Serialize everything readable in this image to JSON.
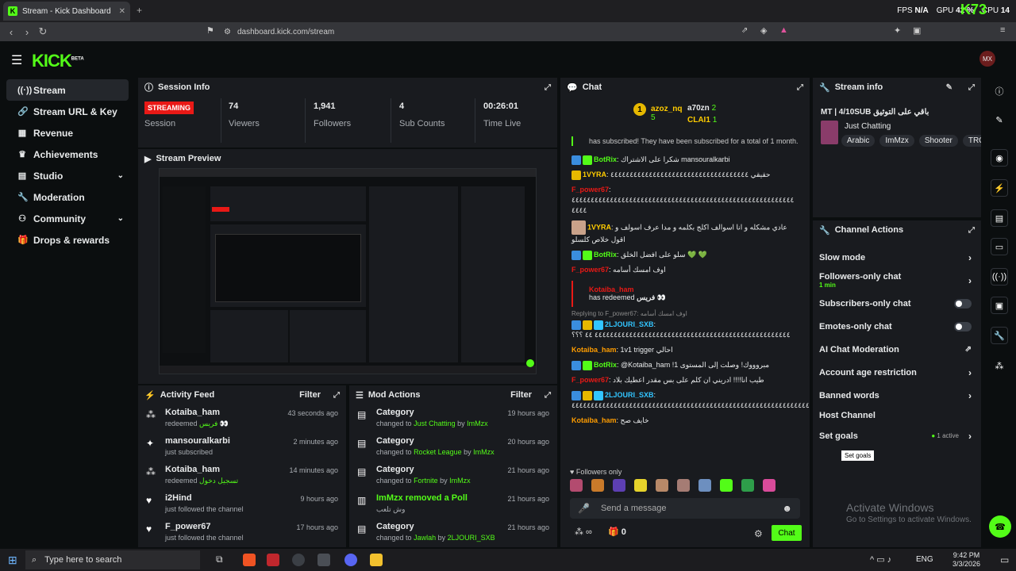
{
  "browser": {
    "tab_title": "Stream - Kick Dashboard",
    "url": "dashboard.kick.com/stream",
    "perf": {
      "fps_label": "FPS",
      "fps": "N/A",
      "gpu_label": "GPU",
      "gpu": "42 %",
      "cpu_label": "CPU",
      "cpu": "14"
    },
    "overlay_logo": "K73"
  },
  "app": {
    "logo": "KICK",
    "logo_sup": "BETA",
    "avatar": "MX"
  },
  "sidebar": {
    "items": [
      {
        "label": "Stream",
        "icon": "signal-icon"
      },
      {
        "label": "Stream URL & Key",
        "icon": "link-icon"
      },
      {
        "label": "Revenue",
        "icon": "chart-icon"
      },
      {
        "label": "Achievements",
        "icon": "trophy-icon"
      },
      {
        "label": "Studio",
        "icon": "studio-icon"
      },
      {
        "label": "Moderation",
        "icon": "wrench-icon"
      },
      {
        "label": "Community",
        "icon": "people-icon"
      },
      {
        "label": "Drops & rewards",
        "icon": "gift-icon"
      }
    ]
  },
  "session": {
    "title": "Session Info",
    "status": "STREAMING",
    "status_label": "Session",
    "viewers": "74",
    "viewers_label": "Viewers",
    "followers": "1,941",
    "followers_label": "Followers",
    "subs": "4",
    "subs_label": "Sub Counts",
    "time": "00:26:01",
    "time_label": "Time Live"
  },
  "preview": {
    "title": "Stream Preview"
  },
  "activity": {
    "title": "Activity Feed",
    "filter": "Filter",
    "items": [
      {
        "user": "Kotaiba_ham",
        "action": "redeemed",
        "extra": "فريس 👀",
        "time": "43 seconds ago"
      },
      {
        "user": "mansouralkarbi",
        "action": "just subscribed",
        "extra": "",
        "time": "2 minutes ago"
      },
      {
        "user": "Kotaiba_ham",
        "action": "redeemed",
        "extra": "تسجيل دخول",
        "time": "14 minutes ago"
      },
      {
        "user": "i2Hind",
        "action": "just followed the channel",
        "extra": "",
        "time": "9 hours ago"
      },
      {
        "user": "F_power67",
        "action": "just followed the channel",
        "extra": "",
        "time": "17 hours ago"
      }
    ]
  },
  "mod": {
    "title": "Mod Actions",
    "filter": "Filter",
    "items": [
      {
        "head": "Category",
        "pre": "changed to",
        "target": "Just Chatting",
        "by": "by",
        "who": "ImMzx",
        "time": "19 hours ago"
      },
      {
        "head": "Category",
        "pre": "changed to",
        "target": "Rocket League",
        "by": "by",
        "who": "ImMzx",
        "time": "20 hours ago"
      },
      {
        "head": "Category",
        "pre": "changed to",
        "target": "Fortnite",
        "by": "by",
        "who": "ImMzx",
        "time": "21 hours ago"
      },
      {
        "head": "ImMzx removed a Poll",
        "pre": "وش تلعب",
        "target": "",
        "by": "",
        "who": "",
        "time": "21 hours ago"
      },
      {
        "head": "Category",
        "pre": "changed to",
        "target": "Jawlah",
        "by": "by",
        "who": "2LJOURI_SXB",
        "time": "21 hours ago"
      }
    ]
  },
  "chat": {
    "title": "Chat",
    "top": [
      {
        "user": "azoz_nq",
        "count": "5"
      },
      {
        "user": "a70zn",
        "count": "2"
      },
      {
        "user": "CLAI1",
        "count": "1"
      }
    ],
    "sub_notice": "has subscribed! They have been subscribed for a total of 1 month.",
    "messages": [
      {
        "user": "BotRix",
        "color": "#53fc18",
        "text": "شكرا على الاشتراك mansouralkarbi"
      },
      {
        "user": "1VYRA",
        "color": "#ffcc00",
        "text": "حقيقي ٤٤٤٤٤٤٤٤٤٤٤٤٤٤٤٤٤٤٤٤٤٤٤٤٤٤٤٤٤٤٤٤٤٤٤٤"
      },
      {
        "user": "F_power67",
        "color": "#e91916",
        "text": "٤٤٤٤٤٤٤٤٤٤٤٤٤٤٤٤٤٤٤٤٤٤٤٤٤٤٤٤٤٤٤٤٤٤٤٤٤٤٤٤٤٤٤٤٤٤٤٤٤٤٤٤٤٤٤٤٤٤ ٤٤٤٤"
      },
      {
        "user": "1VYRA",
        "color": "#ffcc00",
        "text": "عادي مشكله و انا اسوالف اكلج بكلمه و مدا عرف اسولف و اقول خلاص كلسلو"
      },
      {
        "user": "BotRix",
        "color": "#53fc18",
        "text": "سلو على افضل الخلق 💚 💚"
      },
      {
        "user": "F_power67",
        "color": "#e91916",
        "text": "اوف امسك أسامه"
      }
    ],
    "redeem": {
      "user": "Kotaiba_ham",
      "text": "has redeemed",
      "reward": "فريس 👀"
    },
    "reply_to": "Replying to F_power67: اوف امسك أسامه",
    "messages2": [
      {
        "user": "2LJOURI_SXB",
        "color": "#32c5ff",
        "text": "٤٤٤٤٤٤٤٤٤٤٤٤٤٤٤٤٤٤٤٤٤٤٤٤٤٤٤٤٤٤٤٤٤٤٤٤٤٤٤٤٤٤٤٤٤٤٤٤٤٤٤ ٤٤ ؟؟؟"
      },
      {
        "user": "Kotaiba_ham",
        "color": "#ff9d00",
        "text": "1v1 trigger احالي"
      },
      {
        "user": "BotRix",
        "color": "#53fc18",
        "text": "@Kotaiba_ham !مبروووك! وصلت إلى المستوى 1"
      },
      {
        "user": "F_power67",
        "color": "#e91916",
        "text": "طيب انا!!!! ادريني ان كلم على بس مقدر اعطيك بلاد"
      },
      {
        "user": "2LJOURI_SXB",
        "color": "#32c5ff",
        "text": "٤٤٤٤٤٤٤٤٤٤٤٤٤٤٤٤٤٤٤٤٤٤٤٤٤٤٤٤٤٤٤٤٤٤٤٤٤٤٤٤٤٤٤٤٤٤٤٤٤٤٤٤٤٤٤٤٤٤٤٤٤٤"
      },
      {
        "user": "Kotaiba_ham",
        "color": "#ff9d00",
        "text": "خايف صح"
      }
    ],
    "followers_only": "Followers only",
    "placeholder": "Send a message",
    "send": "Chat",
    "count": "0"
  },
  "stream_info": {
    "title": "Stream info",
    "stream_title": "MT | 4/10SUB باقي على التوثيق",
    "category": "Just Chatting",
    "tags": [
      "Arabic",
      "ImMzx",
      "Shooter",
      "TRO"
    ]
  },
  "actions": {
    "title": "Channel Actions",
    "items": [
      {
        "label": "Slow mode",
        "kind": "chev",
        "sub": ""
      },
      {
        "label": "Followers-only chat",
        "kind": "chev",
        "sub": "1 min"
      },
      {
        "label": "Subscribers-only chat",
        "kind": "toggle",
        "sub": ""
      },
      {
        "label": "Emotes-only chat",
        "kind": "toggle",
        "sub": ""
      },
      {
        "label": "AI Chat Moderation",
        "kind": "ext",
        "sub": ""
      },
      {
        "label": "Account age restriction",
        "kind": "chev",
        "sub": ""
      },
      {
        "label": "Banned words",
        "kind": "chev",
        "sub": ""
      },
      {
        "label": "Host Channel",
        "kind": "none",
        "sub": ""
      },
      {
        "label": "Set goals",
        "kind": "chev",
        "sub": ""
      }
    ],
    "goals_active": "1 active",
    "tooltip": "Set goals"
  },
  "watermark": {
    "title": "Activate Windows",
    "sub": "Go to Settings to activate Windows."
  },
  "taskbar": {
    "search": "Type here to search",
    "lang": "ENG",
    "time": "9:42 PM",
    "date": "3/3/2026"
  }
}
